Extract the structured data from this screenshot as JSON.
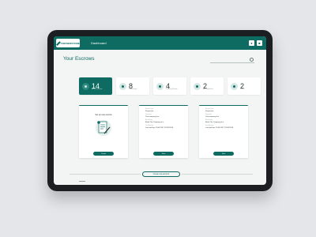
{
  "brand": {
    "logo_text": "CORNERSTONE"
  },
  "nav": {
    "dashboard": "Dashboard"
  },
  "header": {
    "title": "Your Escrows"
  },
  "stats": [
    {
      "value": "14",
      "label": "Active escrows",
      "active": true
    },
    {
      "value": "8",
      "label": "Collectively",
      "active": false
    },
    {
      "value": "4",
      "label": "Pending Review",
      "active": false
    },
    {
      "value": "2",
      "label": "Accomplished",
      "active": false
    },
    {
      "value": "2",
      "label": "Drafts",
      "active": false
    }
  ],
  "setup_card": {
    "title": "Set up new escrow",
    "button": "Create"
  },
  "escrow_cards": [
    {
      "rows": [
        {
          "label": "Escrow Type",
          "value": "Dispersion"
        },
        {
          "label": "Depositor",
          "value": "Techcompany b.v."
        },
        {
          "label": "Beneficiary",
          "value": "Bend The Company b.v."
        },
        {
          "label": "Last Backup",
          "value": "Last backup: 23:08 CET 22/02/2018"
        }
      ],
      "button": "View"
    },
    {
      "rows": [
        {
          "label": "Escrow Type",
          "value": "Dispersion"
        },
        {
          "label": "Depositor",
          "value": "Techcompany b.v."
        },
        {
          "label": "Beneficiary",
          "value": "Bend The Company b.v."
        },
        {
          "label": "Last Backup",
          "value": "Last backup: 23:08 CET 22/02/2018"
        }
      ],
      "button": "View"
    }
  ],
  "footer": {
    "create_link": "Create new account"
  },
  "colors": {
    "accent": "#0d6b61",
    "background": "#f3f4f4"
  }
}
